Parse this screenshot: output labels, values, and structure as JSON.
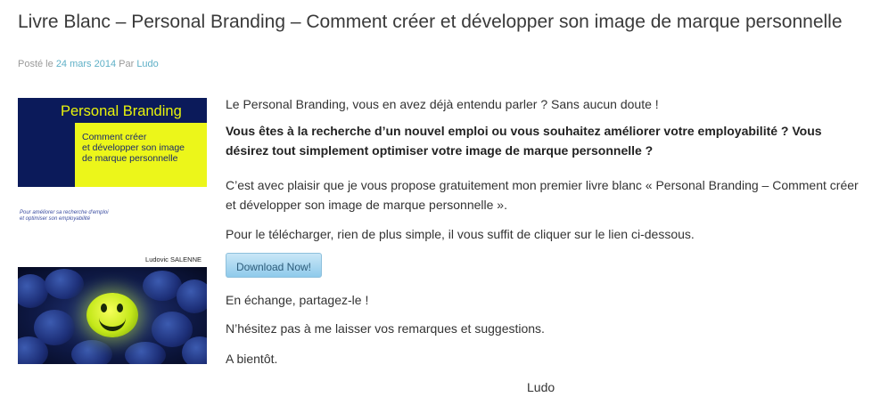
{
  "post": {
    "title": "Livre Blanc – Personal Branding – Comment créer et développer son image de marque personnelle",
    "meta_prefix": "Posté le ",
    "date": "24 mars 2014",
    "meta_by": " Par ",
    "author": "Ludo"
  },
  "cover": {
    "title": "Personal Branding",
    "subtitle_line1": "Comment créer",
    "subtitle_line2": "et développer son image",
    "subtitle_line3": "de marque personnelle",
    "tagline_line1": "Pour améliorer sa recherche d'emploi",
    "tagline_line2": "et optimiser son employabilité",
    "author": "Ludovic SALENNE"
  },
  "content": {
    "p1": "Le Personal Branding, vous en avez déjà entendu parler ? Sans aucun doute !",
    "p2": "Vous êtes à la recherche d’un nouvel emploi ou vous souhaitez améliorer votre employabilité ? Vous désirez tout simplement optimiser votre image de marque personnelle ?",
    "p3": "C’est avec plaisir que je vous propose gratuitement mon premier livre blanc « Personal Branding – Comment créer et développer son image de marque personnelle ».",
    "p4": "Pour le télécharger, rien de plus simple, il vous suffit de cliquer sur le lien ci-dessous.",
    "download_label": "Download Now!",
    "p5": "En échange, partagez-le !",
    "p6": "N’hésitez pas à me laisser vos remarques et suggestions.",
    "p7": "A bientôt.",
    "signature": "Ludo"
  }
}
